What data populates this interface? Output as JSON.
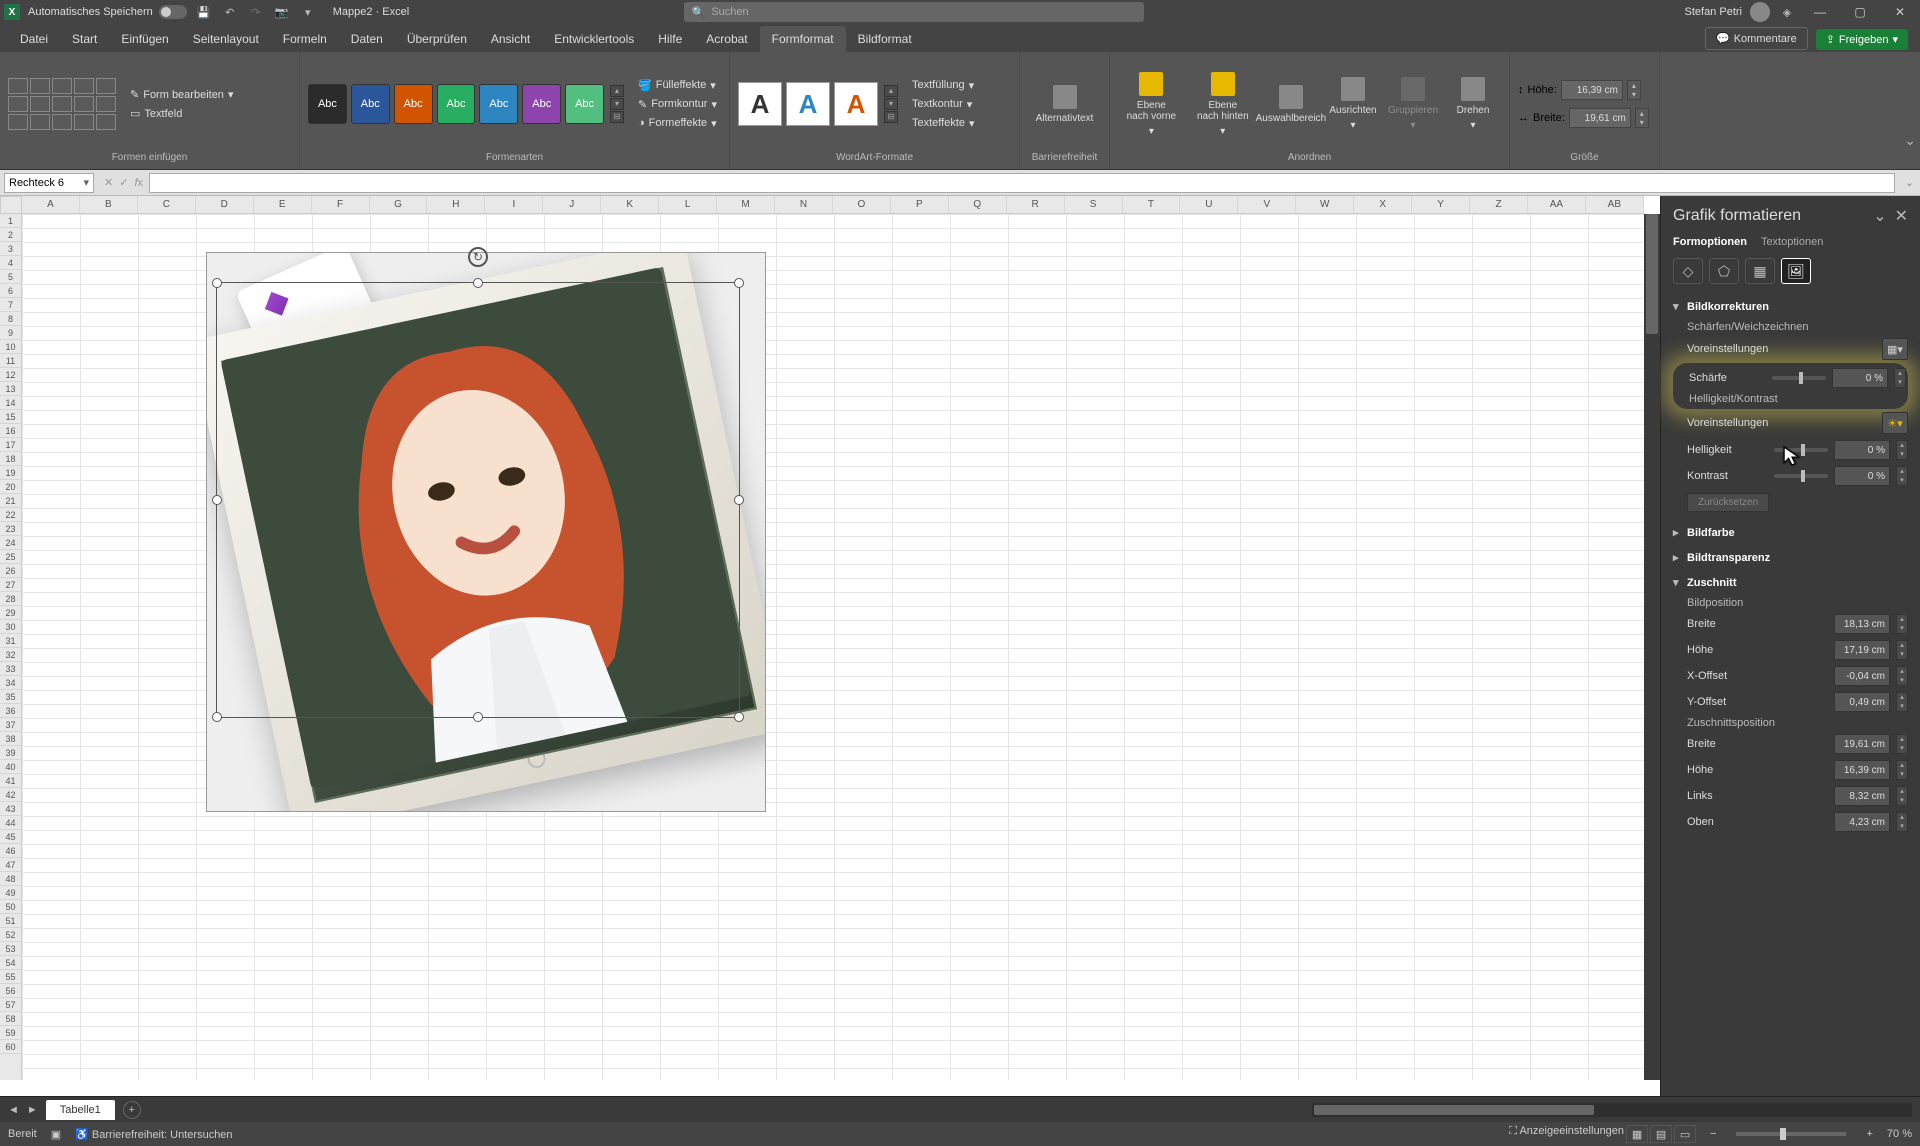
{
  "title": {
    "autosave": "Automatisches Speichern",
    "doc": "Mappe2",
    "app": "Excel",
    "search_ph": "Suchen",
    "user": "Stefan Petri"
  },
  "tabs": {
    "file": "Datei",
    "home": "Start",
    "insert": "Einfügen",
    "layout": "Seitenlayout",
    "formulas": "Formeln",
    "data": "Daten",
    "review": "Überprüfen",
    "view": "Ansicht",
    "developer": "Entwicklertools",
    "help": "Hilfe",
    "acrobat": "Acrobat",
    "shape": "Formformat",
    "picture": "Bildformat",
    "comments": "Kommentare",
    "share": "Freigeben"
  },
  "ribbon": {
    "g1_label": "Formen einfügen",
    "edit_shape": "Form bearbeiten",
    "textbox": "Textfeld",
    "style_text": "Abc",
    "g2_label": "Formenarten",
    "fill": "Fülleffekte",
    "outline": "Formkontur",
    "effects": "Formeffekte",
    "g3_label": "WordArt-Formate",
    "tfill": "Textfüllung",
    "toutline": "Textkontur",
    "teffects": "Texteffekte",
    "alt": "Alternativtext",
    "g4_label": "Barrierefreiheit",
    "fwd": "Ebene nach vorne",
    "back": "Ebene nach hinten",
    "selpane": "Auswahlbereich",
    "align": "Ausrichten",
    "group": "Gruppieren",
    "rotate": "Drehen",
    "g5_label": "Anordnen",
    "h_lbl": "Höhe:",
    "w_lbl": "Breite:",
    "h_val": "16,39 cm",
    "w_val": "19,61 cm",
    "g6_label": "Größe"
  },
  "namebox": "Rechteck 6",
  "cols": [
    "A",
    "B",
    "C",
    "D",
    "E",
    "F",
    "G",
    "H",
    "I",
    "J",
    "K",
    "L",
    "M",
    "N",
    "O",
    "P",
    "Q",
    "R",
    "S",
    "T",
    "U",
    "V",
    "W",
    "X",
    "Y",
    "Z",
    "AA",
    "AB"
  ],
  "panel": {
    "title": "Grafik formatieren",
    "tab1": "Formoptionen",
    "tab2": "Textoptionen",
    "sec_corr": "Bildkorrekturen",
    "sharpen_soft": "Schärfen/Weichzeichnen",
    "presets": "Voreinstellungen",
    "sharp": "Schärfe",
    "sharp_v": "0 %",
    "brightcontrast": "Helligkeit/Kontrast",
    "presets2": "Voreinstellungen",
    "bright": "Helligkeit",
    "bright_v": "0 %",
    "contrast": "Kontrast",
    "contrast_v": "0 %",
    "reset": "Zurücksetzen",
    "sec_color": "Bildfarbe",
    "sec_trans": "Bildtransparenz",
    "sec_crop": "Zuschnitt",
    "pic_pos": "Bildposition",
    "width": "Breite",
    "width_v": "18,13 cm",
    "height": "Höhe",
    "height_v": "17,19 cm",
    "xoff": "X-Offset",
    "xoff_v": "-0,04 cm",
    "yoff": "Y-Offset",
    "yoff_v": "0,49 cm",
    "crop_pos": "Zuschnittsposition",
    "cwidth": "Breite",
    "cwidth_v": "19,61 cm",
    "cheight": "Höhe",
    "cheight_v": "16,39 cm",
    "left": "Links",
    "left_v": "8,32 cm",
    "top": "Oben",
    "top_v": "4,23 cm"
  },
  "sheet_tab": "Tabelle1",
  "status": {
    "ready": "Bereit",
    "acc": "Barrierefreiheit: Untersuchen",
    "display": "Anzeigeeinstellungen",
    "zoom": "70 %"
  }
}
